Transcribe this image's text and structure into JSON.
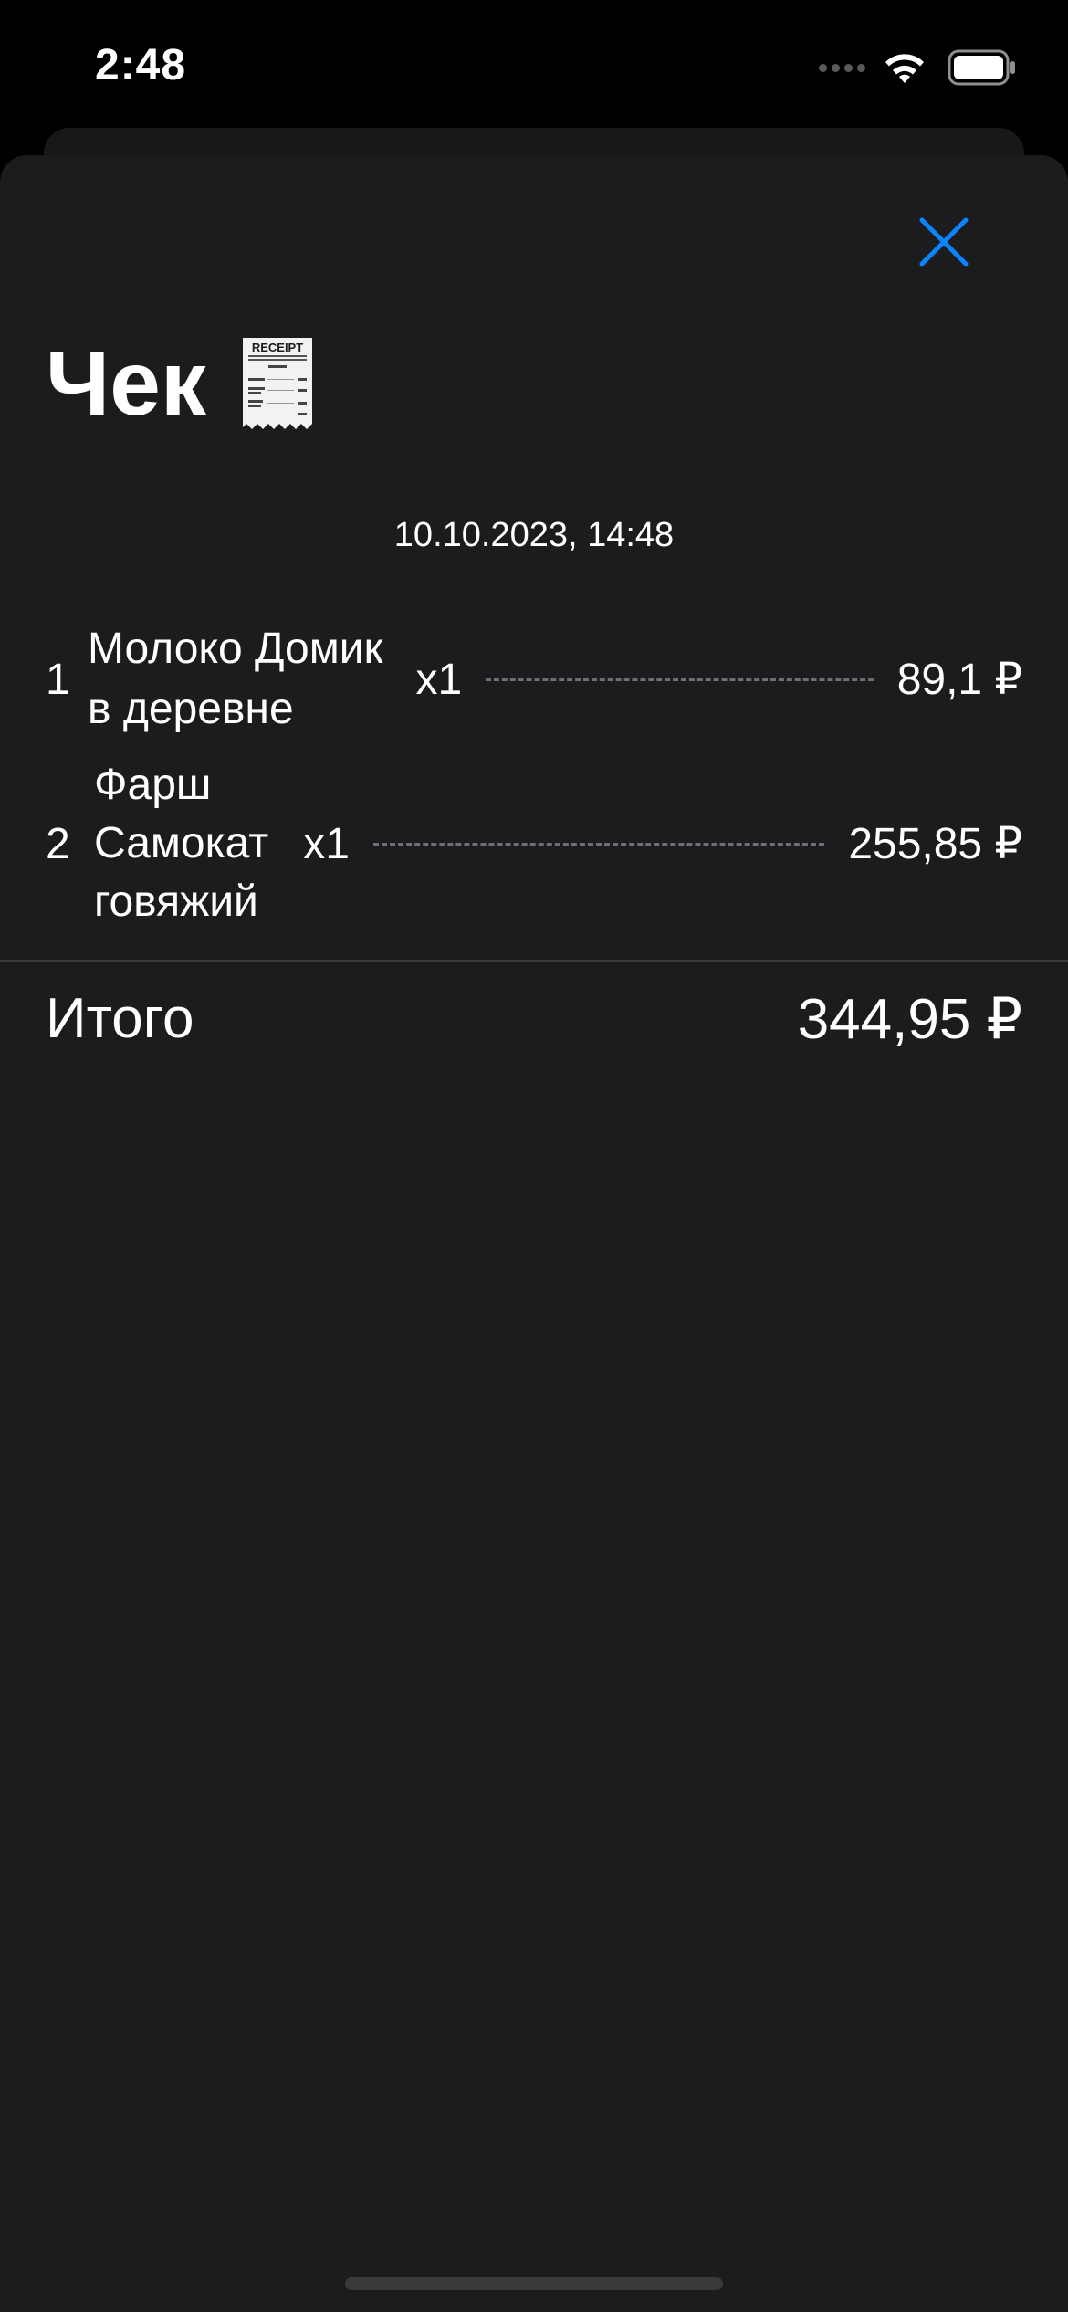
{
  "status_bar": {
    "time": "2:48"
  },
  "sheet": {
    "close_icon": "xmark-icon",
    "title": "Чек",
    "title_icon": "receipt-icon",
    "receipt_icon_text": "RECEIPT",
    "date": "10.10.2023, 14:48",
    "items": [
      {
        "index": "1",
        "name_lines": [
          "Молоко Домик",
          "в деревне"
        ],
        "quantity": "x1",
        "price": "89,1 ₽"
      },
      {
        "index": "2",
        "name_lines": [
          "Фарш",
          "Самокат",
          "говяжий"
        ],
        "quantity": "x1",
        "price": "255,85 ₽"
      }
    ],
    "total_label": "Итого",
    "total_value": "344,95 ₽"
  },
  "colors": {
    "background": "#000000",
    "sheet": "#1c1c1e",
    "accent": "#0a84ff",
    "text": "#ffffff",
    "separator": "#3a3a3c"
  }
}
